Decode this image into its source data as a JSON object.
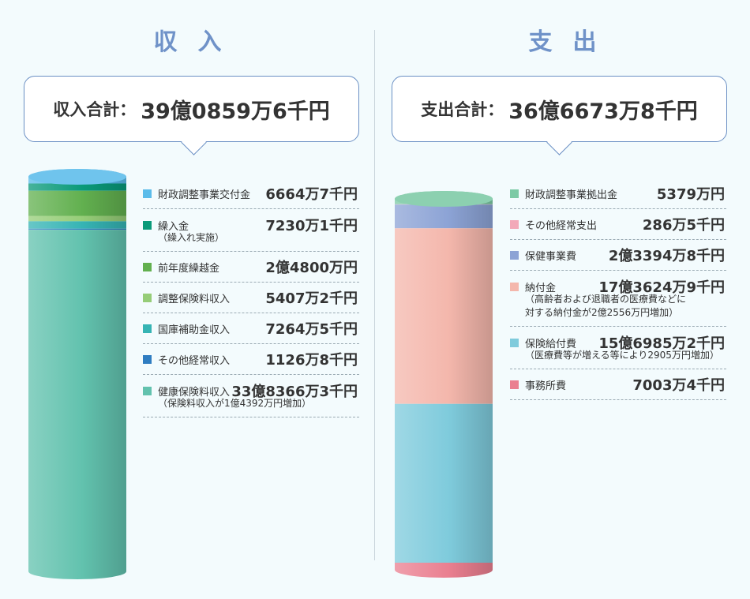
{
  "chart_data": [
    {
      "type": "stacked-bar",
      "title": "収入",
      "total": {
        "label": "収入合計：",
        "value": "39億0859万6千円"
      },
      "series": [
        {
          "name": "財政調整事業交付金",
          "value": 6647,
          "label": "6664万7千円",
          "color": "#5bbcea"
        },
        {
          "name": "繰入金",
          "note": "（繰入れ実施）",
          "value": 7230.1,
          "label": "7230万1千円",
          "color": "#0a9a79"
        },
        {
          "name": "前年度繰越金",
          "value": 24800,
          "label": "2億4800万円",
          "color": "#62b04f"
        },
        {
          "name": "調整保険料収入",
          "value": 5407.2,
          "label": "5407万2千円",
          "color": "#96cd78"
        },
        {
          "name": "国庫補助金収入",
          "value": 7264.5,
          "label": "7264万5千円",
          "color": "#36b4b4"
        },
        {
          "name": "その他経常収入",
          "value": 1126.8,
          "label": "1126万8千円",
          "color": "#2f7dc1"
        },
        {
          "name": "健康保険料収入",
          "note": "（保険料収入が1億4392万円増加）",
          "value": 338366.3,
          "label": "33億8366万3千円",
          "color": "#62c2ae"
        }
      ]
    },
    {
      "type": "stacked-bar",
      "title": "支出",
      "total": {
        "label": "支出合計：",
        "value": "36億6673万8千円"
      },
      "series": [
        {
          "name": "財政調整事業拠出金",
          "value": 5379,
          "label": "5379万円",
          "color": "#7ccaa5"
        },
        {
          "name": "その他経常支出",
          "value": 286.5,
          "label": "286万5千円",
          "color": "#f2a9b9"
        },
        {
          "name": "保健事業費",
          "value": 23394.8,
          "label": "2億3394万8千円",
          "color": "#8ca3d5"
        },
        {
          "name": "納付金",
          "note": "（高齢者および退職者の医療費などに対する納付金が2億2556万円増加）",
          "note_lines": [
            "（高齢者および退職者の医療費などに",
            "対する納付金が2億2556万円増加）"
          ],
          "value": 173624.9,
          "label": "17億3624万9千円",
          "color": "#f4b7ac"
        },
        {
          "name": "保険給付費",
          "note": "（医療費等が増える等により2905万円増加）",
          "value": 156985.2,
          "label": "15億6985万2千円",
          "color": "#7fcbdc"
        },
        {
          "name": "事務所費",
          "value": 7003.4,
          "label": "7003万4千円",
          "color": "#ea7f90"
        }
      ]
    }
  ]
}
